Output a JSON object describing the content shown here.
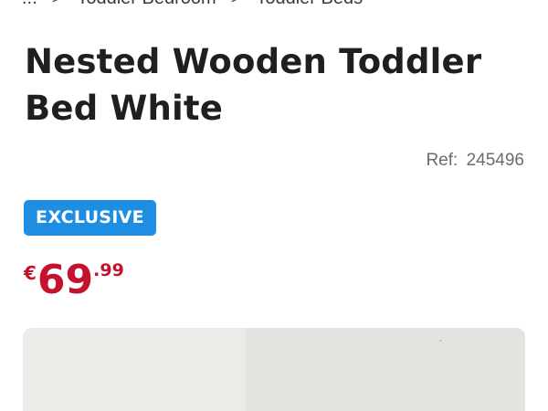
{
  "breadcrumb": {
    "items": [
      "...",
      "Toddler Bedroom",
      "Toddler Beds"
    ],
    "separator": ">"
  },
  "product": {
    "title": "Nested Wooden Toddler Bed White",
    "ref_label": "Ref:",
    "ref_value": "245496",
    "badge": "EXCLUSIVE",
    "price": {
      "currency": "€",
      "integer": "69",
      "decimal": ".99"
    }
  },
  "colors": {
    "badge_bg": "#1e8ee2",
    "price": "#c5122f",
    "title": "#1f1f1f"
  }
}
